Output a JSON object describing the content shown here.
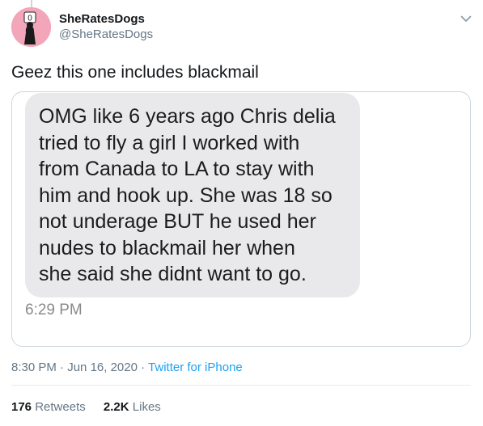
{
  "author": {
    "display_name": "SheRatesDogs",
    "handle": "@SheRatesDogs"
  },
  "tweet": {
    "text": "Geez this one includes blackmail"
  },
  "quoted_message": {
    "lines": [
      "OMG like 6 years ago Chris delia",
      "tried to fly a girl I worked with",
      "from Canada to LA to stay with",
      "him and hook up. She was 18 so",
      "not underage BUT he used her",
      "nudes to blackmail her when",
      "she said she didnt want to go."
    ],
    "time": "6:29 PM"
  },
  "meta": {
    "time": "8:30 PM",
    "sep1": " · ",
    "date": "Jun 16, 2020",
    "sep2": " · ",
    "source": "Twitter for iPhone"
  },
  "stats": {
    "retweets_count": "176",
    "retweets_label": "Retweets",
    "likes_count": "2.2K",
    "likes_label": "Likes"
  },
  "colors": {
    "accent": "#1da1f2",
    "avatar_bg": "#f3a6b9",
    "bubble_bg": "#e9e9eb"
  }
}
